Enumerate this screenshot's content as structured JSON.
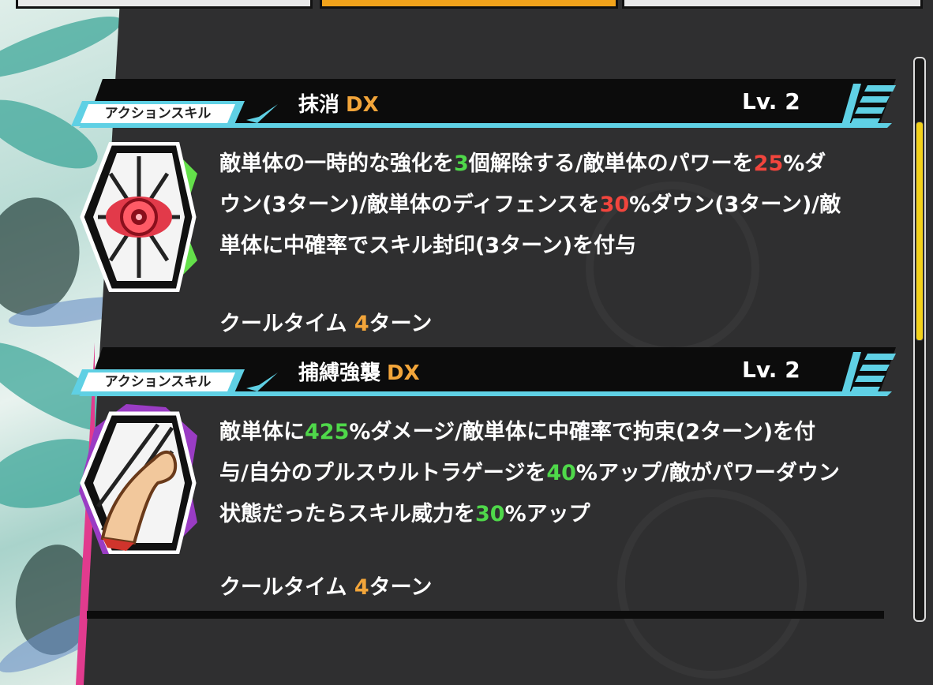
{
  "tabs": [
    "",
    "",
    ""
  ],
  "skills": [
    {
      "type_label": "アクションスキル",
      "name": "抹消",
      "grade": "DX",
      "level": "Lv. 2",
      "icon": "eye-icon",
      "desc": [
        {
          "t": "敵単体の一時的な強化を"
        },
        {
          "t": "3",
          "c": "green"
        },
        {
          "t": "個解除する/敵単体のパワーを"
        },
        {
          "t": "25",
          "c": "red"
        },
        {
          "t": "%ダウン(3ターン)/敵単体のディフェンスを"
        },
        {
          "t": "30",
          "c": "red"
        },
        {
          "t": "%ダウン(3ターン)/敵単体に中確率でスキル封印(3ターン)を付与"
        }
      ],
      "cooldown_label": "クールタイム",
      "cooldown_value": "4",
      "cooldown_unit": "ターン"
    },
    {
      "type_label": "アクションスキル",
      "name": "捕縛強襲",
      "grade": "DX",
      "level": "Lv. 2",
      "icon": "flexed-arm-icon",
      "desc": [
        {
          "t": "敵単体に"
        },
        {
          "t": "425",
          "c": "green"
        },
        {
          "t": "%ダメージ/敵単体に中確率で拘束(2ターン)を付与/自分のプルスウルトラゲージを"
        },
        {
          "t": "40",
          "c": "green"
        },
        {
          "t": "%アップ/敵がパワーダウン状態だったらスキル威力を"
        },
        {
          "t": "30",
          "c": "green"
        },
        {
          "t": "%アップ"
        }
      ],
      "cooldown_label": "クールタイム",
      "cooldown_value": "4",
      "cooldown_unit": "ターン"
    }
  ],
  "colors": {
    "accent_cyan": "#5fd0e4",
    "highlight_orange": "#f2a53a",
    "highlight_red": "#f2453d",
    "highlight_green": "#4fd84a",
    "scroll_thumb": "#f3d21a",
    "panel_edge_pink": "#e13b8e"
  }
}
